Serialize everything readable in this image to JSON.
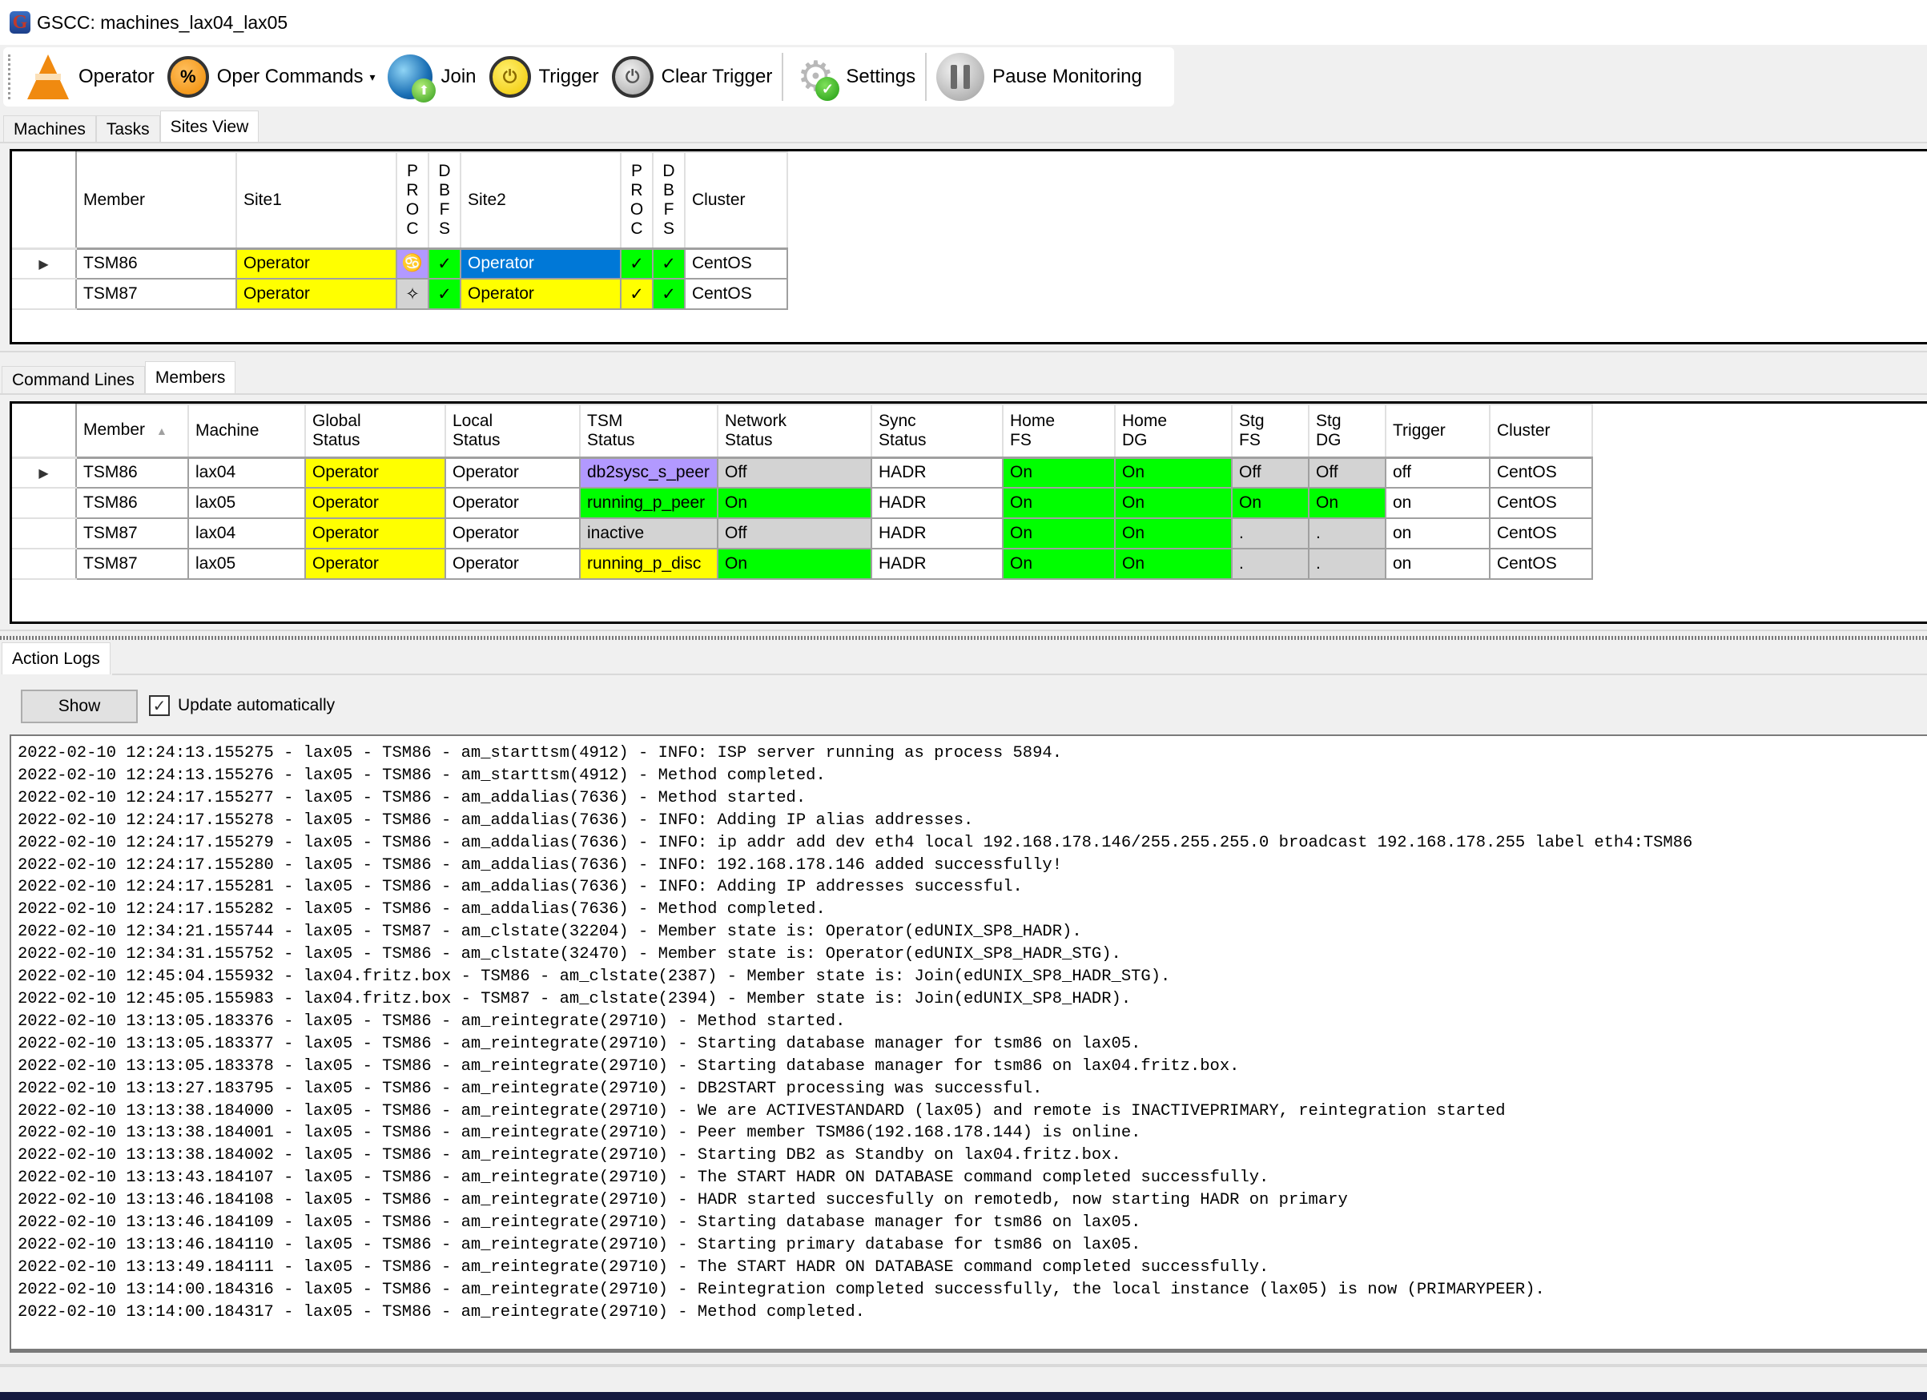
{
  "window": {
    "title": "GSCC: machines_lax04_lax05",
    "app_icon_letter": "G"
  },
  "toolbar": {
    "items": [
      {
        "label": "Operator",
        "icon": "traffic-cone-icon"
      },
      {
        "label": "Oper Commands",
        "icon": "oper-commands-icon",
        "dropdown": true
      },
      {
        "label": "Join",
        "icon": "globe-join-icon"
      },
      {
        "label": "Trigger",
        "icon": "power-yellow-icon"
      },
      {
        "label": "Clear Trigger",
        "icon": "power-grey-icon"
      },
      {
        "label": "Settings",
        "icon": "gear-check-icon"
      },
      {
        "label": "Pause Monitoring",
        "icon": "pause-icon"
      }
    ],
    "dropdown_glyph": "▾",
    "glyphs": {
      "oper": "%",
      "power": "⏻",
      "gear": "⚙",
      "check": "✓"
    }
  },
  "top_tabs": {
    "items": [
      "Machines",
      "Tasks",
      "Sites View"
    ],
    "active": "Sites View"
  },
  "sites_view": {
    "columns": {
      "member": "Member",
      "site1": "Site1",
      "proc1": [
        "P",
        "R",
        "O",
        "C"
      ],
      "dbfs1": [
        "D",
        "B",
        "F",
        "S"
      ],
      "site2": "Site2",
      "proc2": [
        "P",
        "R",
        "O",
        "C"
      ],
      "dbfs2": [
        "D",
        "B",
        "F",
        "S"
      ],
      "cluster": "Cluster"
    },
    "rows": [
      {
        "selected": true,
        "member": "TSM86",
        "site1": "Operator",
        "proc1": "♋",
        "dbfs1": "✓",
        "site2": "Operator",
        "proc2": "✓",
        "dbfs2": "✓",
        "cluster": "CentOS"
      },
      {
        "selected": false,
        "member": "TSM87",
        "site1": "Operator",
        "proc1": "✧",
        "dbfs1": "✓",
        "site2": "Operator",
        "proc2": "✓",
        "dbfs2": "✓",
        "cluster": "CentOS"
      }
    ],
    "row_indicator": "▶"
  },
  "bottom_tabs": {
    "items": [
      "Command Lines",
      "Members"
    ],
    "active": "Members"
  },
  "members": {
    "columns": {
      "member": "Member",
      "machine": "Machine",
      "global_status": [
        "Global",
        "Status"
      ],
      "local_status": [
        "Local",
        "Status"
      ],
      "tsm_status": [
        "TSM",
        "Status"
      ],
      "network_status": [
        "Network",
        "Status"
      ],
      "sync_status": [
        "Sync",
        "Status"
      ],
      "home_fs": [
        "Home",
        "FS"
      ],
      "home_dg": [
        "Home",
        "DG"
      ],
      "stg_fs": [
        "Stg",
        "FS"
      ],
      "stg_dg": [
        "Stg",
        "DG"
      ],
      "trigger": "Trigger",
      "cluster": "Cluster"
    },
    "sort_glyph": "▲",
    "rows": [
      {
        "selected": true,
        "member": "TSM86",
        "machine": "lax04",
        "global_status": "Operator",
        "local_status": "Operator",
        "tsm_status": "db2sysc_s_peer",
        "network_status": "Off",
        "sync_status": "HADR",
        "home_fs": "On",
        "home_dg": "On",
        "stg_fs": "Off",
        "stg_dg": "Off",
        "trigger": "off",
        "cluster": "CentOS"
      },
      {
        "selected": false,
        "member": "TSM86",
        "machine": "lax05",
        "global_status": "Operator",
        "local_status": "Operator",
        "tsm_status": "running_p_peer",
        "network_status": "On",
        "sync_status": "HADR",
        "home_fs": "On",
        "home_dg": "On",
        "stg_fs": "On",
        "stg_dg": "On",
        "trigger": "on",
        "cluster": "CentOS"
      },
      {
        "selected": false,
        "member": "TSM87",
        "machine": "lax04",
        "global_status": "Operator",
        "local_status": "Operator",
        "tsm_status": "inactive",
        "network_status": "Off",
        "sync_status": "HADR",
        "home_fs": "On",
        "home_dg": "On",
        "stg_fs": ".",
        "stg_dg": ".",
        "trigger": "on",
        "cluster": "CentOS"
      },
      {
        "selected": false,
        "member": "TSM87",
        "machine": "lax05",
        "global_status": "Operator",
        "local_status": "Operator",
        "tsm_status": "running_p_disc",
        "network_status": "On",
        "sync_status": "HADR",
        "home_fs": "On",
        "home_dg": "On",
        "stg_fs": ".",
        "stg_dg": ".",
        "trigger": "on",
        "cluster": "CentOS"
      }
    ]
  },
  "action_logs": {
    "tab_label": "Action Logs",
    "show_button": "Show",
    "update_auto_label": "Update automatically",
    "update_auto_checked": true,
    "check_glyph": "✓",
    "lines": [
      "2022-02-10 12:24:13.155275 - lax05 - TSM86 - am_starttsm(4912) - INFO: ISP server running as process 5894.",
      "2022-02-10 12:24:13.155276 - lax05 - TSM86 - am_starttsm(4912) - Method completed.",
      "2022-02-10 12:24:17.155277 - lax05 - TSM86 - am_addalias(7636) - Method started.",
      "2022-02-10 12:24:17.155278 - lax05 - TSM86 - am_addalias(7636) - INFO: Adding IP alias addresses.",
      "2022-02-10 12:24:17.155279 - lax05 - TSM86 - am_addalias(7636) - INFO: ip addr add dev eth4 local 192.168.178.146/255.255.255.0 broadcast 192.168.178.255 label eth4:TSM86",
      "2022-02-10 12:24:17.155280 - lax05 - TSM86 - am_addalias(7636) - INFO: 192.168.178.146 added successfully!",
      "2022-02-10 12:24:17.155281 - lax05 - TSM86 - am_addalias(7636) - INFO: Adding IP addresses successful.",
      "2022-02-10 12:24:17.155282 - lax05 - TSM86 - am_addalias(7636) - Method completed.",
      "2022-02-10 12:34:21.155744 - lax05 - TSM87 - am_clstate(32204) - Member state is: Operator(edUNIX_SP8_HADR).",
      "2022-02-10 12:34:31.155752 - lax05 - TSM86 - am_clstate(32470) - Member state is: Operator(edUNIX_SP8_HADR_STG).",
      "2022-02-10 12:45:04.155932 - lax04.fritz.box - TSM86 - am_clstate(2387) - Member state is: Join(edUNIX_SP8_HADR_STG).",
      "2022-02-10 12:45:05.155983 - lax04.fritz.box - TSM87 - am_clstate(2394) - Member state is: Join(edUNIX_SP8_HADR).",
      "2022-02-10 13:13:05.183376 - lax05 - TSM86 - am_reintegrate(29710) - Method started.",
      "2022-02-10 13:13:05.183377 - lax05 - TSM86 - am_reintegrate(29710) - Starting database manager for tsm86 on lax05.",
      "2022-02-10 13:13:05.183378 - lax05 - TSM86 - am_reintegrate(29710) - Starting database manager for tsm86 on lax04.fritz.box.",
      "2022-02-10 13:13:27.183795 - lax05 - TSM86 - am_reintegrate(29710) - DB2START processing was successful.",
      "2022-02-10 13:13:38.184000 - lax05 - TSM86 - am_reintegrate(29710) - We are ACTIVESTANDARD (lax05) and remote is INACTIVEPRIMARY, reintegration started",
      "2022-02-10 13:13:38.184001 - lax05 - TSM86 - am_reintegrate(29710) - Peer member TSM86(192.168.178.144) is online.",
      "2022-02-10 13:13:38.184002 - lax05 - TSM86 - am_reintegrate(29710) - Starting DB2 as Standby on lax04.fritz.box.",
      "2022-02-10 13:13:43.184107 - lax05 - TSM86 - am_reintegrate(29710) - The START HADR ON DATABASE command completed successfully.",
      "2022-02-10 13:13:46.184108 - lax05 - TSM86 - am_reintegrate(29710) - HADR started succesfully on remotedb, now starting HADR on primary",
      "2022-02-10 13:13:46.184109 - lax05 - TSM86 - am_reintegrate(29710) - Starting database manager for tsm86 on lax05.",
      "2022-02-10 13:13:46.184110 - lax05 - TSM86 - am_reintegrate(29710) - Starting primary database for tsm86 on lax05.",
      "2022-02-10 13:13:49.184111 - lax05 - TSM86 - am_reintegrate(29710) - The START HADR ON DATABASE command completed successfully.",
      "2022-02-10 13:14:00.184316 - lax05 - TSM86 - am_reintegrate(29710) - Reintegration completed successfully, the local instance (lax05) is now (PRIMARYPEER).",
      "2022-02-10 13:14:00.184317 - lax05 - TSM86 - am_reintegrate(29710) - Method completed."
    ]
  },
  "colors": {
    "yellow": "#ffff00",
    "green": "#00ff00",
    "grey": "#d3d3d3",
    "purple": "#b299ff",
    "selected_blue": "#0078d7"
  }
}
